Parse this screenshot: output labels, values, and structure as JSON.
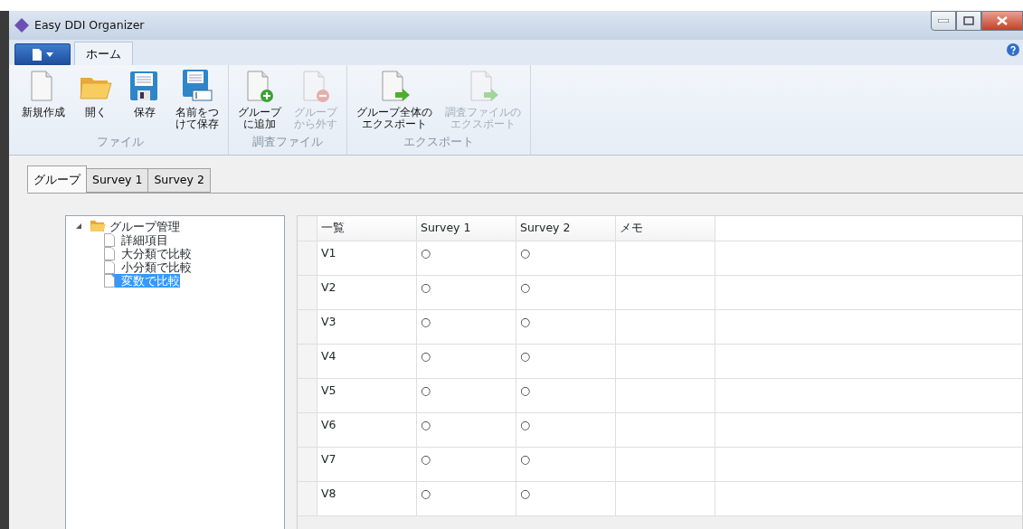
{
  "window": {
    "title": "Easy DDI Organizer"
  },
  "ribbon_tabs": [
    {
      "label": "ホーム",
      "selected": true
    }
  ],
  "ribbon_groups": [
    {
      "label": "ファイル",
      "buttons": [
        {
          "label": "新規作成",
          "kind": "new",
          "disabled": false
        },
        {
          "label": "開く",
          "kind": "open",
          "disabled": false
        },
        {
          "label": "保存",
          "kind": "save",
          "disabled": false
        },
        {
          "label_lines": [
            "名前をつ",
            "けて保存"
          ],
          "kind": "saveas",
          "disabled": false
        }
      ]
    },
    {
      "label": "調査ファイル",
      "buttons": [
        {
          "label_lines": [
            "グループ",
            "に追加"
          ],
          "kind": "add",
          "disabled": false
        },
        {
          "label_lines": [
            "グループ",
            "から外す"
          ],
          "kind": "remove",
          "disabled": true
        }
      ]
    },
    {
      "label": "エクスポート",
      "buttons": [
        {
          "label_lines": [
            "グループ全体の",
            "エクスポート"
          ],
          "kind": "export",
          "disabled": false
        },
        {
          "label_lines": [
            "調査ファイルの",
            "エクスポート"
          ],
          "kind": "export",
          "disabled": true
        }
      ]
    }
  ],
  "doc_tabs": [
    {
      "label": "グループ",
      "selected": true
    },
    {
      "label": "Survey 1",
      "selected": false
    },
    {
      "label": "Survey 2",
      "selected": false
    }
  ],
  "tree": {
    "label": "グループ管理",
    "expanded": true,
    "children": [
      {
        "label": "詳細項目",
        "selected": false
      },
      {
        "label": "大分類で比較",
        "selected": false
      },
      {
        "label": "小分類で比較",
        "selected": false
      },
      {
        "label": "変数で比較",
        "selected": true
      }
    ]
  },
  "table": {
    "columns": [
      "一覧",
      "Survey 1",
      "Survey 2",
      "メモ"
    ],
    "rows": [
      {
        "cells": [
          "V1",
          "○",
          "○",
          ""
        ]
      },
      {
        "cells": [
          "V2",
          "○",
          "○",
          ""
        ]
      },
      {
        "cells": [
          "V3",
          "○",
          "○",
          ""
        ]
      },
      {
        "cells": [
          "V4",
          "○",
          "○",
          ""
        ]
      },
      {
        "cells": [
          "V5",
          "○",
          "○",
          ""
        ]
      },
      {
        "cells": [
          "V6",
          "○",
          "○",
          ""
        ]
      },
      {
        "cells": [
          "V7",
          "○",
          "○",
          ""
        ]
      },
      {
        "cells": [
          "V8",
          "○",
          "○",
          ""
        ]
      }
    ]
  }
}
